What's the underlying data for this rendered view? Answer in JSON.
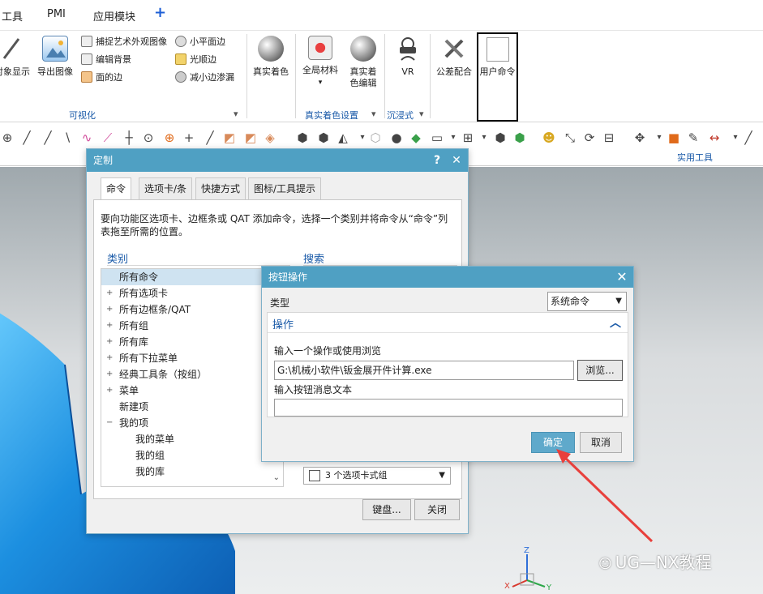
{
  "menubar": {
    "items": [
      "工具",
      "PMI",
      "应用模块"
    ],
    "plus_icon": "plus-icon"
  },
  "ribbon": {
    "large_buttons": [
      {
        "label": "对象显示",
        "icon": "object-display-icon"
      },
      {
        "label": "导出图像",
        "icon": "export-image-icon"
      },
      {
        "label": "真实着色",
        "icon": "true-shading-sphere-icon"
      },
      {
        "label": "全局材料",
        "icon": "global-material-icon"
      },
      {
        "label": "真实着色编辑",
        "label_line1": "真实着",
        "label_line2": "色编辑",
        "icon": "shading-edit-icon"
      },
      {
        "label": "VR",
        "icon": "vr-headset-icon"
      },
      {
        "label": "公差配合",
        "icon": "tools-icon"
      },
      {
        "label": "用户命令",
        "icon": "user-command-icon"
      }
    ],
    "small_buttons": [
      {
        "label": "捕捉艺术外观图像",
        "icon": "capture-image-icon"
      },
      {
        "label": "编辑背景",
        "icon": "edit-background-icon"
      },
      {
        "label": "面的边",
        "icon": "face-edge-icon"
      },
      {
        "label": "小平面边",
        "icon": "facet-edge-icon"
      },
      {
        "label": "光顺边",
        "icon": "smooth-edge-icon"
      },
      {
        "label": "减小边渗漏",
        "icon": "reduce-edge-bleed-icon"
      }
    ],
    "groups": {
      "visualize": "可视化",
      "true_shading_settings": "真实着色设置",
      "immersive": "沉浸式"
    }
  },
  "toolbar": {
    "utility_group": "实用工具"
  },
  "customize_dialog": {
    "title": "定制",
    "help_icon": "?",
    "close_icon": "✕",
    "tabs": [
      "命令",
      "选项卡/条",
      "快捷方式",
      "图标/工具提示"
    ],
    "description": "要向功能区选项卡、边框条或 QAT 添加命令，选择一个类别并将命令从“命令”列表拖至所需的位置。",
    "category_label": "类别",
    "search_label": "搜索",
    "categories": [
      {
        "label": "所有命令",
        "selected": true,
        "expand": ""
      },
      {
        "label": "所有选项卡",
        "expand": "+"
      },
      {
        "label": "所有边框条/QAT",
        "expand": "+"
      },
      {
        "label": "所有组",
        "expand": "+"
      },
      {
        "label": "所有库",
        "expand": "+"
      },
      {
        "label": "所有下拉菜单",
        "expand": "+"
      },
      {
        "label": "经典工具条（按组）",
        "expand": "+"
      },
      {
        "label": "菜单",
        "expand": "+"
      },
      {
        "label": "新建项",
        "expand": ""
      },
      {
        "label": "我的项",
        "expand": "−"
      },
      {
        "label": "我的菜单",
        "expand": "",
        "indent": true
      },
      {
        "label": "我的组",
        "expand": "",
        "indent": true
      },
      {
        "label": "我的库",
        "expand": "",
        "indent": true
      }
    ],
    "tab_group_select": "3 个选项卡式组",
    "keyboard_button": "键盘...",
    "close_button": "关闭"
  },
  "button_action_dialog": {
    "title": "按钮操作",
    "close_icon": "✕",
    "type_label": "类型",
    "type_value": "系统命令",
    "section_title": "操作",
    "input_label": "输入一个操作或使用浏览",
    "input_value": "G:\\机械小软件\\钣金展开件计算.exe",
    "browse_button": "浏览...",
    "message_label": "输入按钮消息文本",
    "message_value": "",
    "ok_button": "确定",
    "cancel_button": "取消"
  },
  "watermark": "UG—NX教程",
  "axis_labels": {
    "z": "Z",
    "x": "X",
    "y": "Y"
  },
  "colors": {
    "dialog_title": "#4fa0c3",
    "group_label": "#1a5aa8",
    "arrow": "#e8403c",
    "model": "#1c8fe0"
  }
}
